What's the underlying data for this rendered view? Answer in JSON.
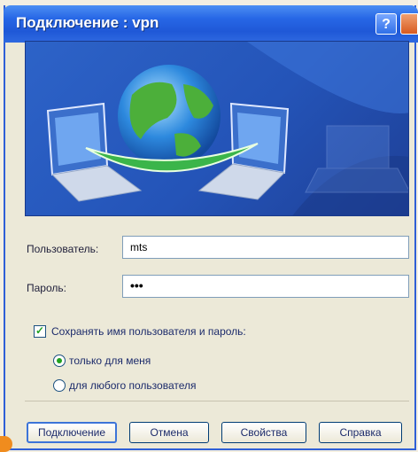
{
  "window": {
    "title": "Подключение : vpn",
    "help_label": "?"
  },
  "form": {
    "user_label": "Пользователь:",
    "user_value": "mts",
    "password_label": "Пароль:",
    "password_value": "•••",
    "save_label": "Сохранять имя пользователя и пароль:",
    "save_checked": true,
    "radio_only_me": "только для меня",
    "radio_any_user": "для любого пользователя",
    "selected_radio": "only_me"
  },
  "buttons": {
    "connect": "Подключение",
    "cancel": "Отмена",
    "properties": "Свойства",
    "help": "Справка"
  },
  "colors": {
    "titlebar": "#2767e6",
    "banner": "#2d63c8",
    "check_accent": "#21a121"
  },
  "icons": {
    "banner": "network-globe-laptops-icon"
  }
}
